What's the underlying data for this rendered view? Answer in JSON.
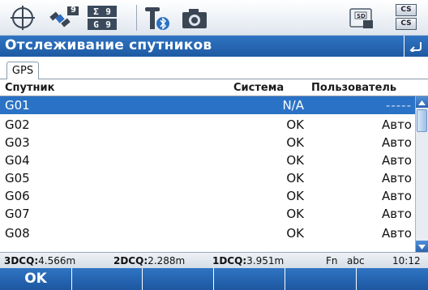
{
  "window": {
    "title": "Отслеживание спутников"
  },
  "status_bar": {
    "satellite_counts": {
      "top": "9",
      "bottom": ""
    },
    "sigma": {
      "sum_label": "Σ",
      "sum_value": "9",
      "g_label": "G",
      "g_value": "9"
    },
    "memory_card_label": "SD",
    "cs_top": "CS",
    "cs_bottom": "CS",
    "icons": [
      "crosshair-icon",
      "satellite-icon",
      "sigma-counter-icon",
      "antenna-bluetooth-icon",
      "camera-icon",
      "sd-card-icon",
      "cs-mode-icon"
    ]
  },
  "tabs": [
    {
      "label": "GPS",
      "active": true
    }
  ],
  "table": {
    "columns": [
      "Спутник",
      "Система",
      "Пользователь"
    ],
    "rows": [
      {
        "satellite": "G01",
        "system": "N/A",
        "user": "-----",
        "selected": true
      },
      {
        "satellite": "G02",
        "system": "OK",
        "user": "Авто"
      },
      {
        "satellite": "G03",
        "system": "OK",
        "user": "Авто"
      },
      {
        "satellite": "G04",
        "system": "OK",
        "user": "Авто"
      },
      {
        "satellite": "G05",
        "system": "OK",
        "user": "Авто"
      },
      {
        "satellite": "G06",
        "system": "OK",
        "user": "Авто"
      },
      {
        "satellite": "G07",
        "system": "OK",
        "user": "Авто"
      },
      {
        "satellite": "G08",
        "system": "OK",
        "user": "Авто"
      }
    ]
  },
  "info_bar": {
    "dcq3_label": "3DCQ:",
    "dcq3_value": "4.566m",
    "dcq2_label": "2DCQ:",
    "dcq2_value": "2.288m",
    "dcq1_label": "1DCQ:",
    "dcq1_value": "3.951m",
    "fn": "Fn",
    "input_mode": "abc",
    "time": "10:12"
  },
  "softkeys": [
    {
      "label": "OK"
    },
    {
      "label": ""
    },
    {
      "label": ""
    },
    {
      "label": ""
    },
    {
      "label": ""
    },
    {
      "label": ""
    }
  ],
  "colors": {
    "accent": "#2a72c6",
    "title_bar": "#1e5aa3",
    "selected_row": "#2a72c6"
  }
}
